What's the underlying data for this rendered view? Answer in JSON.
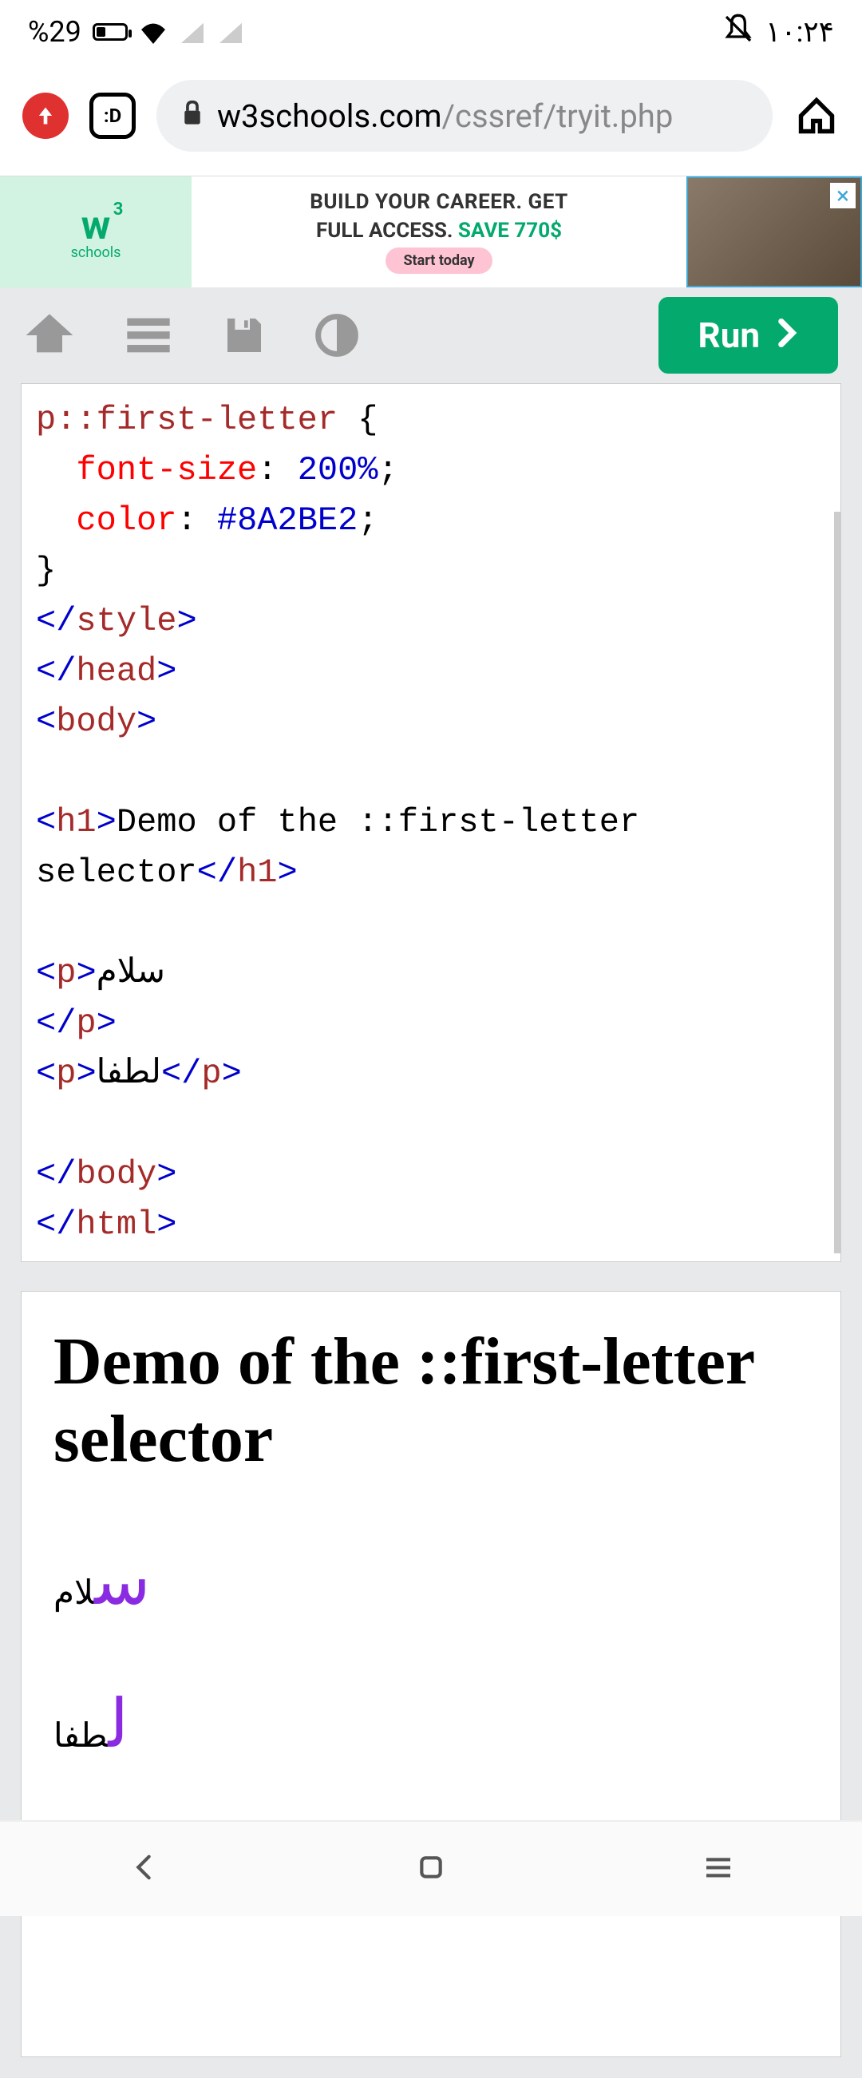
{
  "status": {
    "battery_pct": "%29",
    "time": "۱۰:۲۴"
  },
  "browser": {
    "tab_label": ":D",
    "url_host": "w3schools.com",
    "url_path": "/cssref/tryit.php"
  },
  "ad": {
    "logo_letter": "w",
    "logo_sup": "3",
    "logo_sub": "schools",
    "line1": "BUILD YOUR CAREER. GET",
    "line2_a": "FULL ACCESS. ",
    "line2_b": "SAVE 770$",
    "cta": "Start today",
    "close": "×"
  },
  "toolbar": {
    "run_label": "Run"
  },
  "code": {
    "selector": "p::first-letter",
    "brace_open": " {",
    "prop1_name": "font-size",
    "prop1_val": "200%",
    "prop2_name": "color",
    "prop2_val": "#8A2BE2",
    "brace_close": "}",
    "tag_style_close": "</style>",
    "tag_head_close": "</head>",
    "tag_body_open": "<body>",
    "tag_h1_open": "<h1>",
    "h1_text": "Demo of the ::first-letter selector",
    "tag_h1_close": "</h1>",
    "tag_p_open": "<p>",
    "p1_text": "سلام",
    "tag_p_close": "</p>",
    "p2_text": "لطفا",
    "tag_body_close": "</body>",
    "tag_html_close": "</html>"
  },
  "output": {
    "h1": "Demo of the ::first-letter selector",
    "p1_first": "س",
    "p1_rest": "لام",
    "p2_first": "ل",
    "p2_rest": "طفا"
  }
}
